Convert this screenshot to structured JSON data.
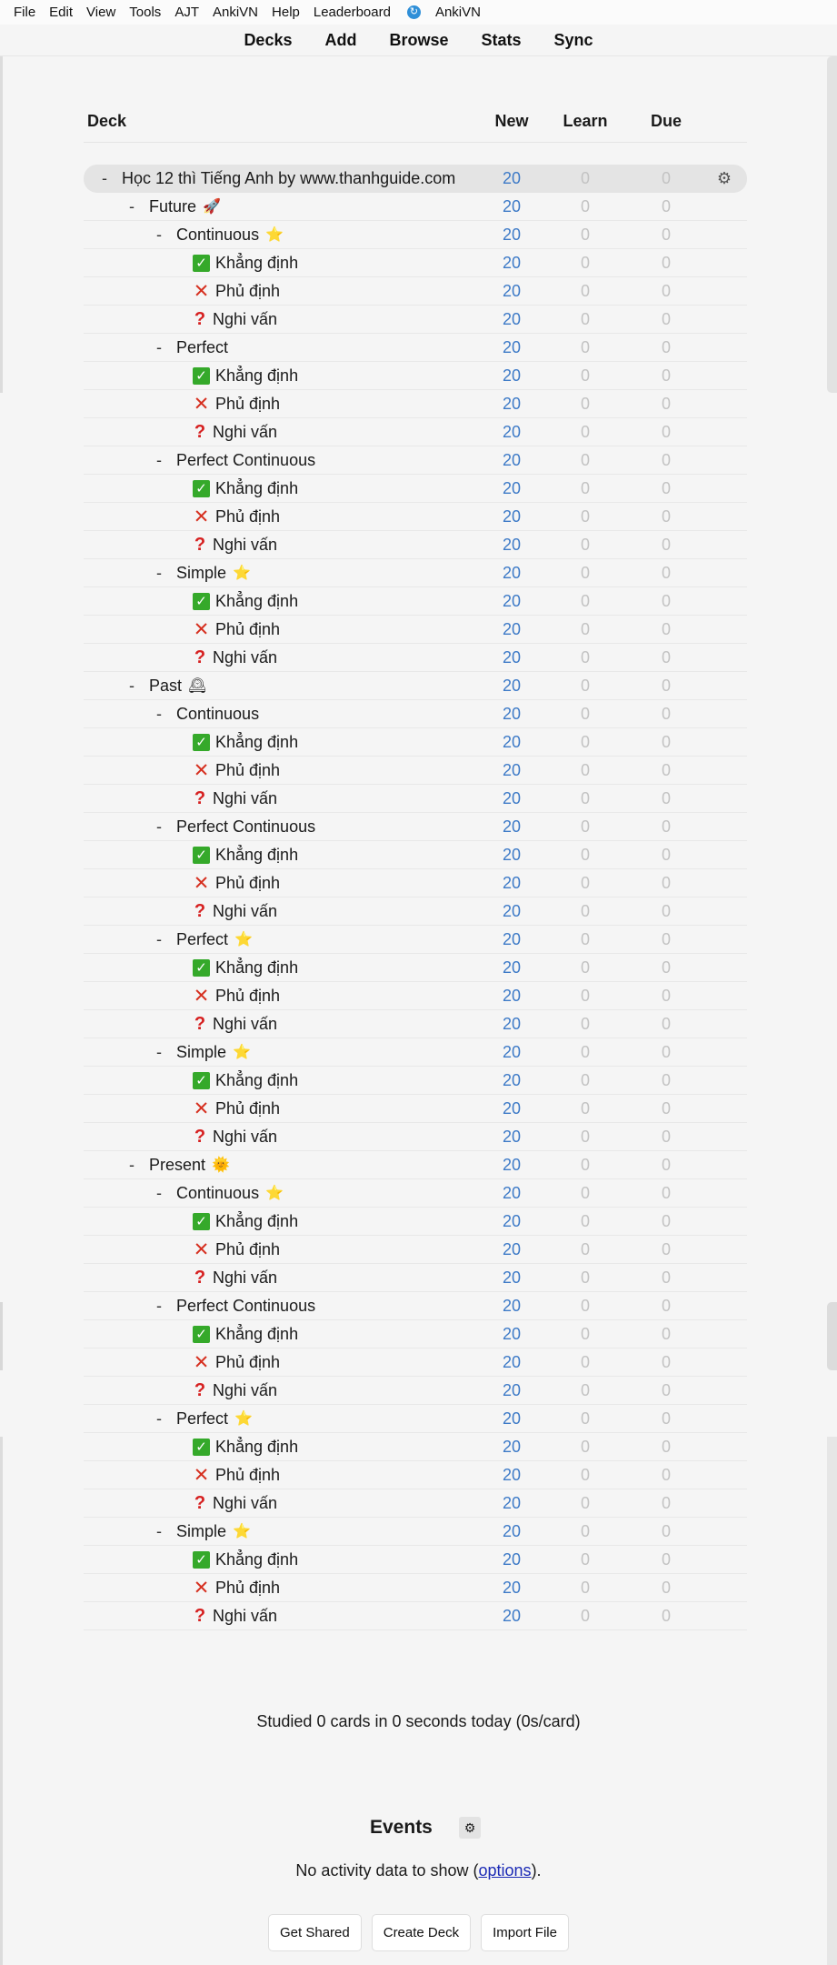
{
  "menu": [
    "File",
    "Edit",
    "View",
    "Tools",
    "AJT",
    "AnkiVN",
    "Help",
    "Leaderboard",
    "AnkiVN"
  ],
  "toolbar": [
    "Decks",
    "Add",
    "Browse",
    "Stats",
    "Sync"
  ],
  "table": {
    "headers": {
      "deck": "Deck",
      "new": "New",
      "learn": "Learn",
      "due": "Due"
    },
    "rows": [
      {
        "level": 0,
        "collapse": "-",
        "name": "Học 12 thì Tiếng Anh by www.thanhguide.com",
        "icon": "",
        "new": "20",
        "learn": "0",
        "due": "0",
        "root": true
      },
      {
        "level": 1,
        "collapse": "-",
        "name": "Future",
        "icon": "rocket",
        "new": "20",
        "learn": "0",
        "due": "0"
      },
      {
        "level": 2,
        "collapse": "-",
        "name": "Continuous",
        "icon": "star",
        "new": "20",
        "learn": "0",
        "due": "0"
      },
      {
        "level": 3,
        "name": "Khẳng định",
        "icon": "check",
        "new": "20",
        "learn": "0",
        "due": "0"
      },
      {
        "level": 3,
        "name": "Phủ định",
        "icon": "cross",
        "new": "20",
        "learn": "0",
        "due": "0"
      },
      {
        "level": 3,
        "name": "Nghi vấn",
        "icon": "question",
        "new": "20",
        "learn": "0",
        "due": "0"
      },
      {
        "level": 2,
        "collapse": "-",
        "name": "Perfect",
        "icon": "",
        "new": "20",
        "learn": "0",
        "due": "0"
      },
      {
        "level": 3,
        "name": "Khẳng định",
        "icon": "check",
        "new": "20",
        "learn": "0",
        "due": "0"
      },
      {
        "level": 3,
        "name": "Phủ định",
        "icon": "cross",
        "new": "20",
        "learn": "0",
        "due": "0"
      },
      {
        "level": 3,
        "name": "Nghi vấn",
        "icon": "question",
        "new": "20",
        "learn": "0",
        "due": "0"
      },
      {
        "level": 2,
        "collapse": "-",
        "name": "Perfect Continuous",
        "icon": "",
        "new": "20",
        "learn": "0",
        "due": "0"
      },
      {
        "level": 3,
        "name": "Khẳng định",
        "icon": "check",
        "new": "20",
        "learn": "0",
        "due": "0"
      },
      {
        "level": 3,
        "name": "Phủ định",
        "icon": "cross",
        "new": "20",
        "learn": "0",
        "due": "0"
      },
      {
        "level": 3,
        "name": "Nghi vấn",
        "icon": "question",
        "new": "20",
        "learn": "0",
        "due": "0"
      },
      {
        "level": 2,
        "collapse": "-",
        "name": "Simple",
        "icon": "star",
        "new": "20",
        "learn": "0",
        "due": "0"
      },
      {
        "level": 3,
        "name": "Khẳng định",
        "icon": "check",
        "new": "20",
        "learn": "0",
        "due": "0"
      },
      {
        "level": 3,
        "name": "Phủ định",
        "icon": "cross",
        "new": "20",
        "learn": "0",
        "due": "0"
      },
      {
        "level": 3,
        "name": "Nghi vấn",
        "icon": "question",
        "new": "20",
        "learn": "0",
        "due": "0"
      },
      {
        "level": 1,
        "collapse": "-",
        "name": "Past",
        "icon": "clock",
        "new": "20",
        "learn": "0",
        "due": "0"
      },
      {
        "level": 2,
        "collapse": "-",
        "name": "Continuous",
        "icon": "",
        "new": "20",
        "learn": "0",
        "due": "0"
      },
      {
        "level": 3,
        "name": "Khẳng định",
        "icon": "check",
        "new": "20",
        "learn": "0",
        "due": "0"
      },
      {
        "level": 3,
        "name": "Phủ định",
        "icon": "cross",
        "new": "20",
        "learn": "0",
        "due": "0"
      },
      {
        "level": 3,
        "name": "Nghi vấn",
        "icon": "question",
        "new": "20",
        "learn": "0",
        "due": "0"
      },
      {
        "level": 2,
        "collapse": "-",
        "name": "Perfect Continuous",
        "icon": "",
        "new": "20",
        "learn": "0",
        "due": "0"
      },
      {
        "level": 3,
        "name": "Khẳng định",
        "icon": "check",
        "new": "20",
        "learn": "0",
        "due": "0"
      },
      {
        "level": 3,
        "name": "Phủ định",
        "icon": "cross",
        "new": "20",
        "learn": "0",
        "due": "0"
      },
      {
        "level": 3,
        "name": "Nghi vấn",
        "icon": "question",
        "new": "20",
        "learn": "0",
        "due": "0"
      },
      {
        "level": 2,
        "collapse": "-",
        "name": "Perfect",
        "icon": "star",
        "new": "20",
        "learn": "0",
        "due": "0"
      },
      {
        "level": 3,
        "name": "Khẳng định",
        "icon": "check",
        "new": "20",
        "learn": "0",
        "due": "0"
      },
      {
        "level": 3,
        "name": "Phủ định",
        "icon": "cross",
        "new": "20",
        "learn": "0",
        "due": "0"
      },
      {
        "level": 3,
        "name": "Nghi vấn",
        "icon": "question",
        "new": "20",
        "learn": "0",
        "due": "0"
      },
      {
        "level": 2,
        "collapse": "-",
        "name": "Simple",
        "icon": "star",
        "new": "20",
        "learn": "0",
        "due": "0"
      },
      {
        "level": 3,
        "name": "Khẳng định",
        "icon": "check",
        "new": "20",
        "learn": "0",
        "due": "0"
      },
      {
        "level": 3,
        "name": "Phủ định",
        "icon": "cross",
        "new": "20",
        "learn": "0",
        "due": "0"
      },
      {
        "level": 3,
        "name": "Nghi vấn",
        "icon": "question",
        "new": "20",
        "learn": "0",
        "due": "0"
      },
      {
        "level": 1,
        "collapse": "-",
        "name": "Present",
        "icon": "sun",
        "new": "20",
        "learn": "0",
        "due": "0"
      },
      {
        "level": 2,
        "collapse": "-",
        "name": "Continuous",
        "icon": "star",
        "new": "20",
        "learn": "0",
        "due": "0"
      },
      {
        "level": 3,
        "name": "Khẳng định",
        "icon": "check",
        "new": "20",
        "learn": "0",
        "due": "0"
      },
      {
        "level": 3,
        "name": "Phủ định",
        "icon": "cross",
        "new": "20",
        "learn": "0",
        "due": "0"
      },
      {
        "level": 3,
        "name": "Nghi vấn",
        "icon": "question",
        "new": "20",
        "learn": "0",
        "due": "0"
      },
      {
        "level": 2,
        "collapse": "-",
        "name": "Perfect Continuous",
        "icon": "",
        "new": "20",
        "learn": "0",
        "due": "0"
      },
      {
        "level": 3,
        "name": "Khẳng định",
        "icon": "check",
        "new": "20",
        "learn": "0",
        "due": "0"
      },
      {
        "level": 3,
        "name": "Phủ định",
        "icon": "cross",
        "new": "20",
        "learn": "0",
        "due": "0"
      },
      {
        "level": 3,
        "name": "Nghi vấn",
        "icon": "question",
        "new": "20",
        "learn": "0",
        "due": "0"
      },
      {
        "level": 2,
        "collapse": "-",
        "name": "Perfect",
        "icon": "star",
        "new": "20",
        "learn": "0",
        "due": "0"
      },
      {
        "level": 3,
        "name": "Khẳng định",
        "icon": "check",
        "new": "20",
        "learn": "0",
        "due": "0"
      },
      {
        "level": 3,
        "name": "Phủ định",
        "icon": "cross",
        "new": "20",
        "learn": "0",
        "due": "0"
      },
      {
        "level": 3,
        "name": "Nghi vấn",
        "icon": "question",
        "new": "20",
        "learn": "0",
        "due": "0"
      },
      {
        "level": 2,
        "collapse": "-",
        "name": "Simple",
        "icon": "star",
        "new": "20",
        "learn": "0",
        "due": "0"
      },
      {
        "level": 3,
        "name": "Khẳng định",
        "icon": "check",
        "new": "20",
        "learn": "0",
        "due": "0"
      },
      {
        "level": 3,
        "name": "Phủ định",
        "icon": "cross",
        "new": "20",
        "learn": "0",
        "due": "0"
      },
      {
        "level": 3,
        "name": "Nghi vấn",
        "icon": "question",
        "new": "20",
        "learn": "0",
        "due": "0"
      }
    ]
  },
  "studied_text": "Studied 0 cards in 0 seconds today (0s/card)",
  "events": {
    "title": "Events",
    "activity_prefix": "No activity data to show (",
    "activity_link": "options",
    "activity_suffix": ")."
  },
  "buttons": {
    "get_shared": "Get Shared",
    "create_deck": "Create Deck",
    "import_file": "Import File"
  },
  "colors": {
    "new": "#3d7ac7",
    "zero": "#c3c3c3",
    "link": "#1b2ab5"
  }
}
